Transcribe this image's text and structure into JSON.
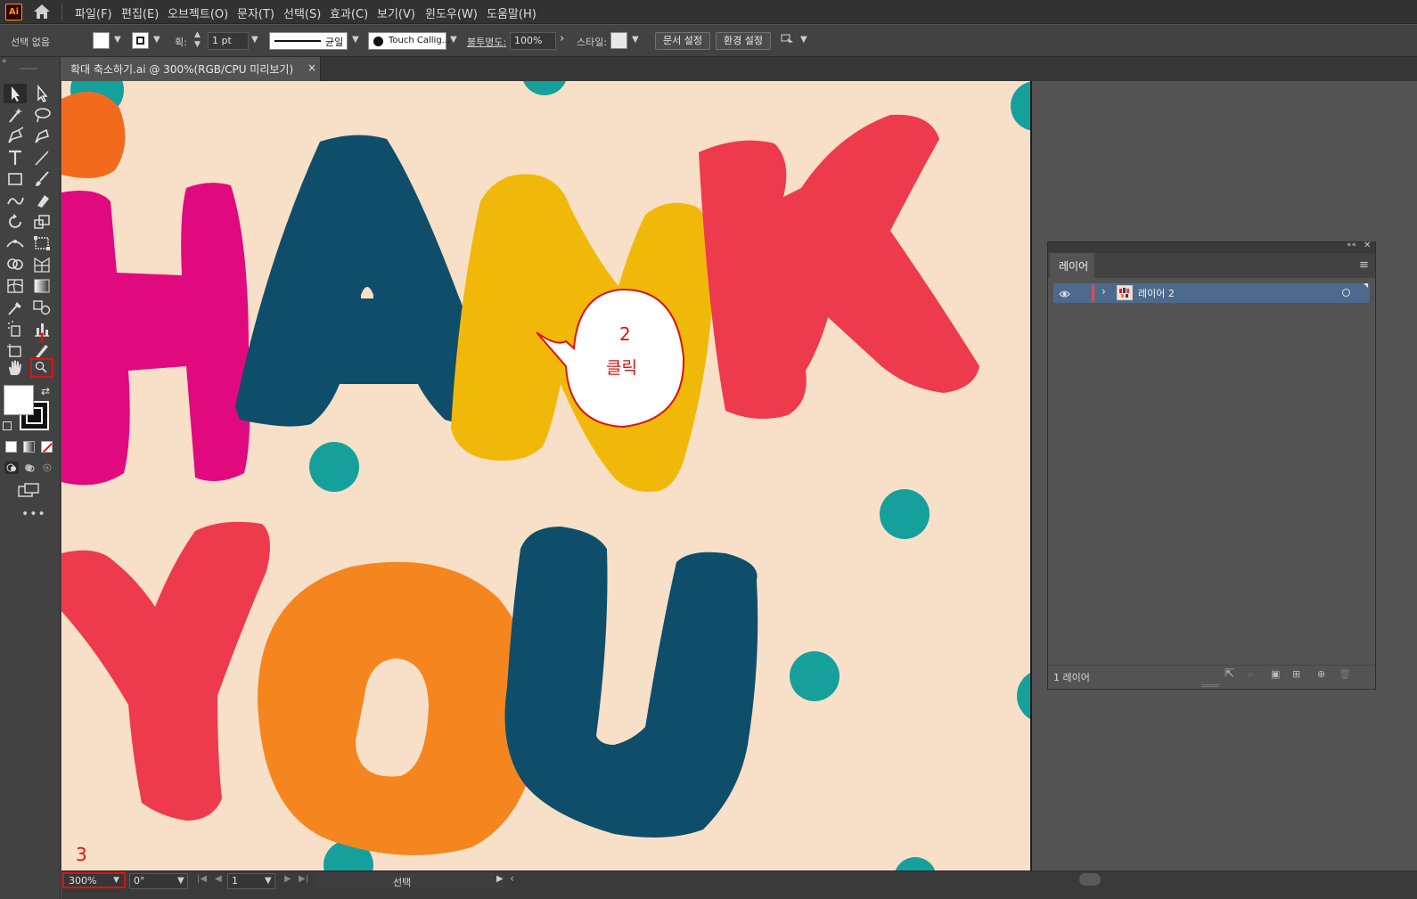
{
  "app": {
    "logo_text": "Ai"
  },
  "menu": [
    "파일(F)",
    "편집(E)",
    "오브젝트(O)",
    "문자(T)",
    "선택(S)",
    "효과(C)",
    "보기(V)",
    "윈도우(W)",
    "도움말(H)"
  ],
  "control_bar": {
    "selection_status": "선택 없음",
    "stroke_label": "획:",
    "stroke_weight": "1 pt",
    "stroke_profile": "균일",
    "brush_name": "Touch Callig...",
    "opacity_label": "불투명도:",
    "opacity_value": "100%",
    "style_label": "스타일:",
    "document_setup_button": "문서 설정",
    "preferences_button": "환경 설정"
  },
  "document_tab": {
    "title": "확대 축소하기.ai @ 300%(RGB/CPU 미리보기)",
    "close": "×"
  },
  "artwork": {
    "word_top": [
      "H",
      "A",
      "N",
      "K"
    ],
    "word_bottom": [
      "Y",
      "O",
      "U"
    ],
    "colors": {
      "H": "#e0097e",
      "A": "#0f4e6a",
      "N": "#f0b90a",
      "K": "#ee3a4d",
      "Y": "#ee3a4d",
      "O": "#f5861f",
      "U": "#0f4e6a",
      "dot": "#16a09c",
      "dot_dark": "#f26b1d"
    }
  },
  "annotations": {
    "marker_1": "1",
    "bubble_number": "2",
    "bubble_text": "클릭",
    "marker_3": "3",
    "annotation_color": "#e0120e"
  },
  "status_bar": {
    "zoom": "300%",
    "rotation": "0°",
    "artboard_number": "1",
    "tool_status": "선택"
  },
  "layers_panel": {
    "tab_label": "레이어",
    "layers": [
      {
        "name": "레이어 2",
        "color": "#e8474c"
      }
    ],
    "footer_count": "1 레이어"
  }
}
